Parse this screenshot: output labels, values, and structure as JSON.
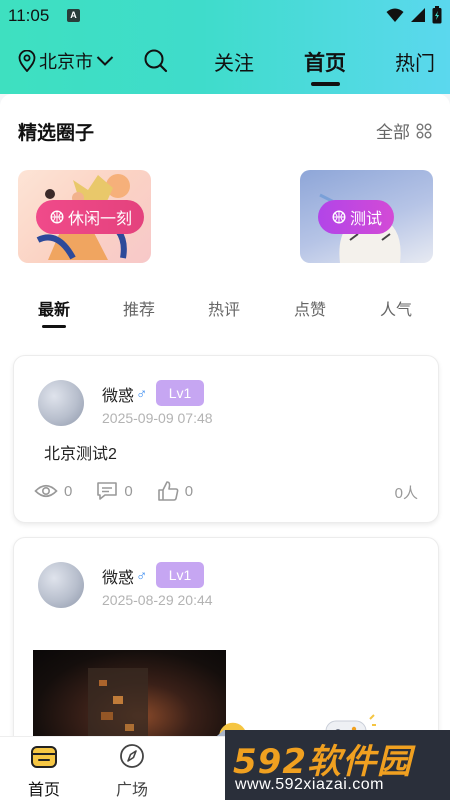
{
  "status": {
    "time": "11:05",
    "notif_icon": "A"
  },
  "header": {
    "location": "北京市",
    "tabs": [
      {
        "label": "关注",
        "active": false
      },
      {
        "label": "首页",
        "active": true
      },
      {
        "label": "热门",
        "active": false
      }
    ],
    "gradient": [
      "#3ee0c0",
      "#5bd8ee"
    ]
  },
  "circles": {
    "title": "精选圈子",
    "all_label": "全部",
    "items": [
      {
        "label": "休闲一刻",
        "color": "#e9457f"
      },
      {
        "label": "测试",
        "color": "#c047e2"
      }
    ]
  },
  "sub_tabs": [
    {
      "label": "最新",
      "active": true
    },
    {
      "label": "推荐",
      "active": false
    },
    {
      "label": "热评",
      "active": false
    },
    {
      "label": "点赞",
      "active": false
    },
    {
      "label": "人气",
      "active": false
    }
  ],
  "posts": [
    {
      "username": "微惑",
      "gender": "♂",
      "level": "Lv1",
      "time": "2025-09-09 07:48",
      "content": "北京测试2",
      "views": "0",
      "comments": "0",
      "likes": "0",
      "people": "0人"
    },
    {
      "username": "微惑",
      "gender": "♂",
      "level": "Lv1",
      "time": "2025-08-29 20:44"
    }
  ],
  "bottom_nav": [
    {
      "label": "首页",
      "active": true,
      "icon": "home-icon"
    },
    {
      "label": "广场",
      "active": false,
      "icon": "compass-icon"
    }
  ],
  "watermark": {
    "brand": "592软件园",
    "url": "www.592xiazai.com"
  }
}
